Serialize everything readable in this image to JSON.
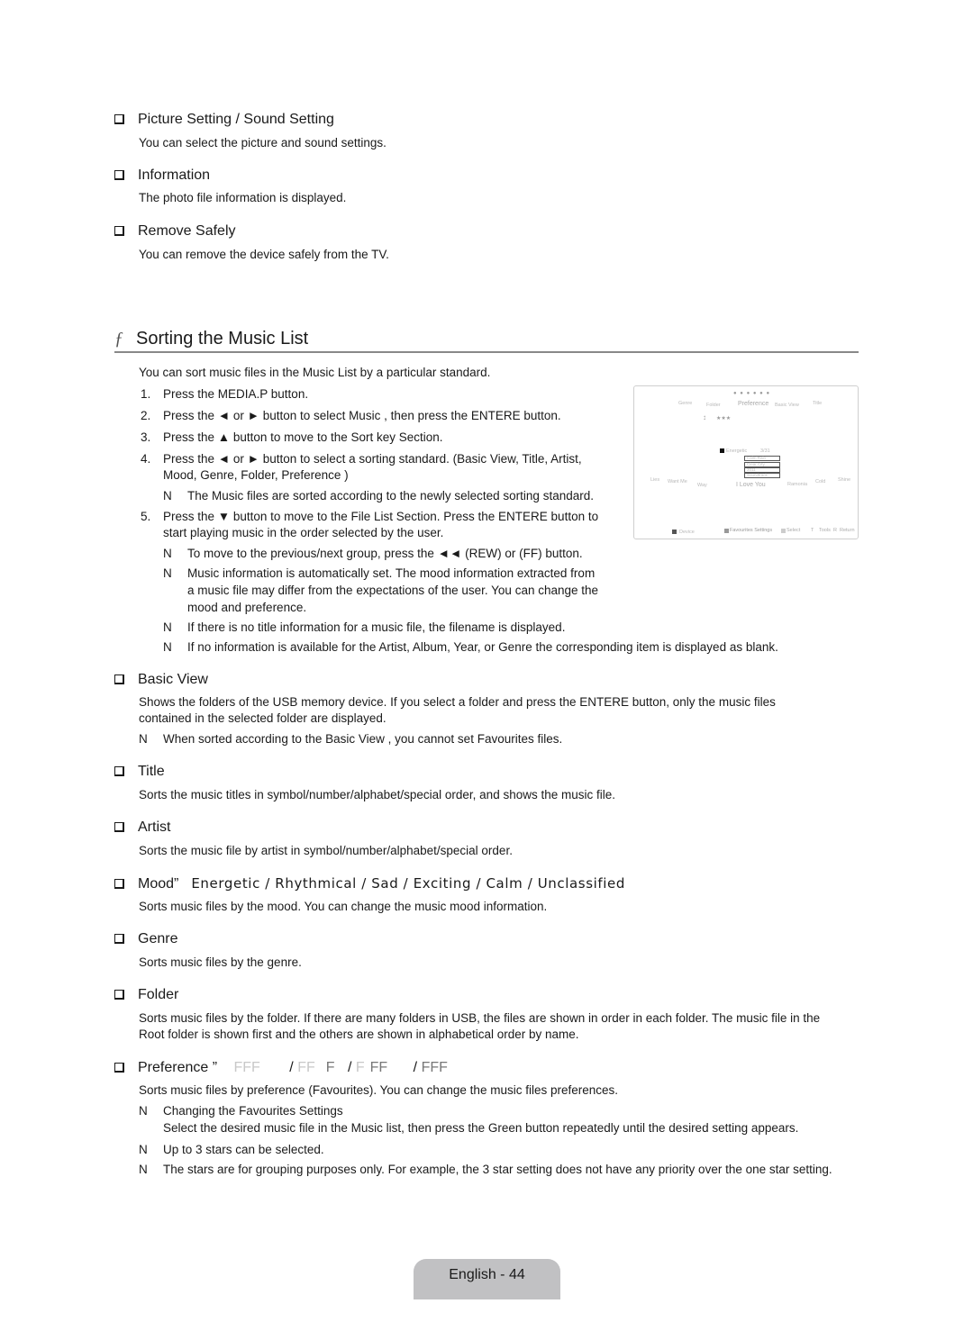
{
  "top_sections": [
    {
      "heading": "Picture Setting / Sound Setting",
      "body": "You can select the picture and sound settings."
    },
    {
      "heading": "Information",
      "body": "The photo file information is displayed."
    },
    {
      "heading": "Remove Safely",
      "body": "You can remove the device safely from the TV."
    }
  ],
  "chapter": {
    "glyph": "ƒ",
    "title": "Sorting the Music List",
    "intro": "You can sort music files in the Music List by a particular standard."
  },
  "steps": [
    {
      "num": "1.",
      "text": "Press the MEDIA.P button."
    },
    {
      "num": "2.",
      "text": "Press the ◄ or ► button to select Music , then press the ENTERE    button."
    },
    {
      "num": "3.",
      "text": "Press the ▲ button to move to the Sort key Section."
    },
    {
      "num": "4.",
      "text": "Press the ◄ or ► button to select a sorting standard. (Basic View, Title, Artist,",
      "text2": "Mood, Genre, Folder, Preference   )"
    },
    {
      "num": "5.",
      "text": "Press the ▼ button to move to the File List Section. Press the ENTERE    button to",
      "text2": "start playing music in the order selected by the user."
    }
  ],
  "notes": {
    "step4": "The Music files are sorted according to the newly selected sorting standard.",
    "step5_a": "To move to the previous/next group, press the ◄◄ (REW) or       (FF) button.",
    "step5_b_1": "Music information is automatically set. The mood information extracted from",
    "step5_b_2": "a music file may differ from the expectations of the user. You can change the",
    "step5_b_3": "mood and preference.",
    "step5_c": "If there is no title information for a music file, the filename is displayed.",
    "step5_d": "If no information is available for the Artist, Album, Year, or Genre the corresponding item is displayed as blank.",
    "marker": "N"
  },
  "screen_inset": {
    "stars": "● ● ● ● ● ●",
    "sort_tabs": [
      "Genre",
      "Folder",
      "Preference",
      "Basic View",
      "Title"
    ],
    "selected_sort": "Preference",
    "group_stars": "★★★",
    "playing_label": "Energetic",
    "counter": "3/31",
    "file_details": [
      "Calm Rain",
      "Clear City",
      "2011",
      "Soundtrack"
    ],
    "songs": [
      "Lies",
      "Want Me",
      "Way",
      "I Love You",
      "Ramonia",
      "Cold",
      "Shine"
    ],
    "center_song": "I Love You",
    "footer": {
      "device": "Device",
      "favourites": "Favourites Settings",
      "select": "Select",
      "tools_icon": "T",
      "tools": "Tools",
      "return_icon": "R",
      "return": "Return"
    }
  },
  "sort_sections": [
    {
      "heading": "Basic View",
      "body1": "Shows the folders of the USB memory device. If you select a folder and press the ENTERE    button, only the music files",
      "body2": "contained in the selected folder are displayed.",
      "note": "When sorted according to the Basic View , you cannot set Favourites files."
    },
    {
      "heading": "Title",
      "body1": "Sorts the music titles in symbol/number/alphabet/special order, and shows the music file."
    },
    {
      "heading": "Artist",
      "body1": "Sorts the music file by artist in symbol/number/alphabet/special order."
    },
    {
      "heading": "Mood”",
      "mood_options": "Energetic / Rhythmical / Sad / Exciting / Calm / Unclassified",
      "body1": "Sorts music files by the mood. You can change the music mood information."
    },
    {
      "heading": "Genre",
      "body1": "Sorts music files by the genre."
    },
    {
      "heading": "Folder",
      "body1": "Sorts music files by the folder. If there are many folders in USB, the files are shown in order in each folder. The music file in the",
      "body2": "Root folder is shown first and the others are shown in alphabetical order by name."
    }
  ],
  "preference": {
    "heading": "Preference ”",
    "levels": [
      {
        "stars_filled": 0,
        "light": "FFF",
        "dark": ""
      },
      {
        "stars_filled": 1,
        "light": "FF",
        "dark": "F"
      },
      {
        "stars_filled": 2,
        "light": "F",
        "dark": "FF"
      },
      {
        "stars_filled": 3,
        "light": "",
        "dark": "FFF"
      }
    ],
    "separator": "/",
    "body": "Sorts music files by preference (Favourites). You can change the music files preferences.",
    "note1_title": "Changing the Favourites Settings",
    "note1_body": "Select the desired music file in the Music list, then press the Green button repeatedly until the desired setting appears.",
    "note2": "Up to 3 stars can be selected.",
    "note3": "The stars are for grouping purposes only. For example, the 3 star setting does not have any priority over the one star setting."
  },
  "footer": {
    "page_label": "English - 44"
  },
  "colors": {
    "text": "#1a1a1a",
    "rule": "#888888",
    "footer_tab": "#c1c1c3",
    "star_empty": "#c8c8c8",
    "star_filled": "#777777"
  }
}
